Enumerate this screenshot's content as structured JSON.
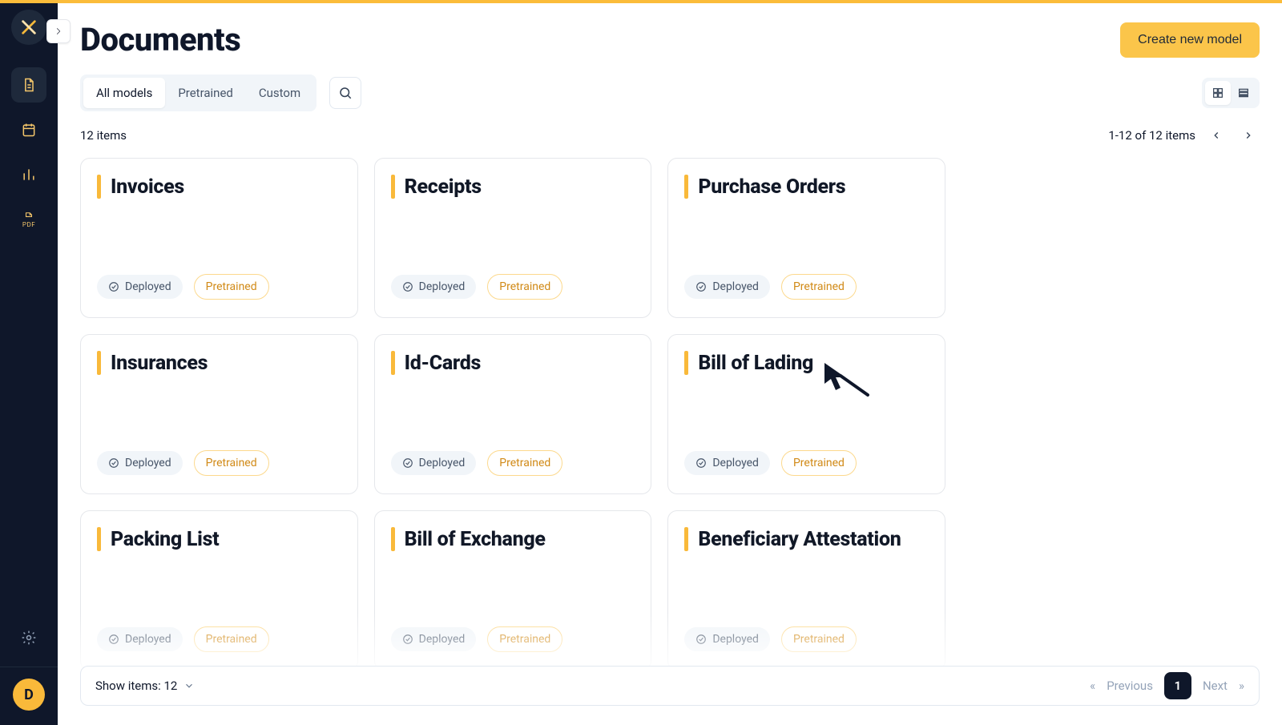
{
  "brand": {
    "avatar_initial": "D"
  },
  "page": {
    "title": "Documents"
  },
  "actions": {
    "create_new_model": "Create new model"
  },
  "filters": {
    "tabs": [
      {
        "label": "All models",
        "active": true
      },
      {
        "label": "Pretrained",
        "active": false
      },
      {
        "label": "Custom",
        "active": false
      }
    ]
  },
  "counts": {
    "total_label": "12 items",
    "range_label": "1-12 of 12 items"
  },
  "cards": [
    {
      "title": "Invoices",
      "status": "Deployed",
      "tag": "Pretrained"
    },
    {
      "title": "Receipts",
      "status": "Deployed",
      "tag": "Pretrained"
    },
    {
      "title": "Purchase Orders",
      "status": "Deployed",
      "tag": "Pretrained"
    },
    {
      "title": "Insurances",
      "status": "Deployed",
      "tag": "Pretrained"
    },
    {
      "title": "Id-Cards",
      "status": "Deployed",
      "tag": "Pretrained"
    },
    {
      "title": "Bill of Lading",
      "status": "Deployed",
      "tag": "Pretrained"
    },
    {
      "title": "Packing List",
      "status": "Deployed",
      "tag": "Pretrained"
    },
    {
      "title": "Bill of Exchange",
      "status": "Deployed",
      "tag": "Pretrained"
    },
    {
      "title": "Beneficiary Attestation",
      "status": "Deployed",
      "tag": "Pretrained"
    }
  ],
  "footer": {
    "show_items_label": "Show items: 12",
    "prev_label": "Previous",
    "next_label": "Next",
    "current_page": "1",
    "first_symbol": "«",
    "last_symbol": "»"
  }
}
